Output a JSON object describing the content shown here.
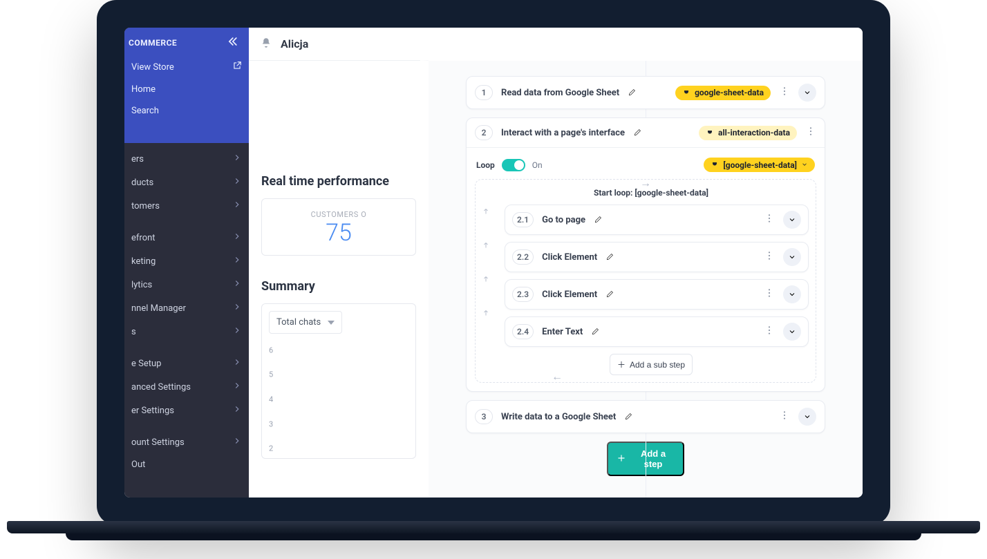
{
  "brand": "COMMERCE",
  "collapse_hint": "Collapse",
  "topbar": {
    "title": "Alicja"
  },
  "side_primary": [
    {
      "label": "View Store",
      "external": true
    },
    {
      "label": "Home",
      "external": false
    },
    {
      "label": "Search",
      "external": false
    }
  ],
  "side_groups": [
    [
      "ers",
      "ducts",
      "tomers"
    ],
    [
      "efront",
      "keting",
      "lytics",
      "nnel Manager",
      "s"
    ],
    [
      "e Setup",
      "anced Settings",
      "er Settings"
    ],
    [
      "ount Settings",
      "Out"
    ]
  ],
  "dashboard": {
    "realtime_title": "Real time performance",
    "stat_label": "CUSTOMERS O",
    "stat_value": "75",
    "summary_title": "Summary",
    "select_label": "Total chats"
  },
  "chart_data": {
    "type": "line",
    "title": "",
    "xlabel": "",
    "ylabel": "",
    "ylim": [
      2,
      6
    ],
    "yticks": [
      6,
      5,
      4,
      3,
      2
    ],
    "series": []
  },
  "flow": {
    "steps": [
      {
        "num": "1",
        "title": "Read data from Google Sheet",
        "chip": "google-sheet-data"
      },
      {
        "num": "2",
        "title": "Interact with a page's interface",
        "chip": "all-interaction-data"
      },
      {
        "num": "3",
        "title": "Write data to a Google Sheet"
      }
    ],
    "loop": {
      "label": "Loop",
      "state": "On",
      "source_chip": "[google-sheet-data]",
      "start_label": "Start loop: [google-sheet-data]",
      "sub": [
        {
          "num": "2.1",
          "title": "Go to page"
        },
        {
          "num": "2.2",
          "title": "Click Element"
        },
        {
          "num": "2.3",
          "title": "Click Element"
        },
        {
          "num": "2.4",
          "title": "Enter Text"
        }
      ],
      "add_sub": "Add a sub step"
    },
    "add_step": "Add a step"
  }
}
